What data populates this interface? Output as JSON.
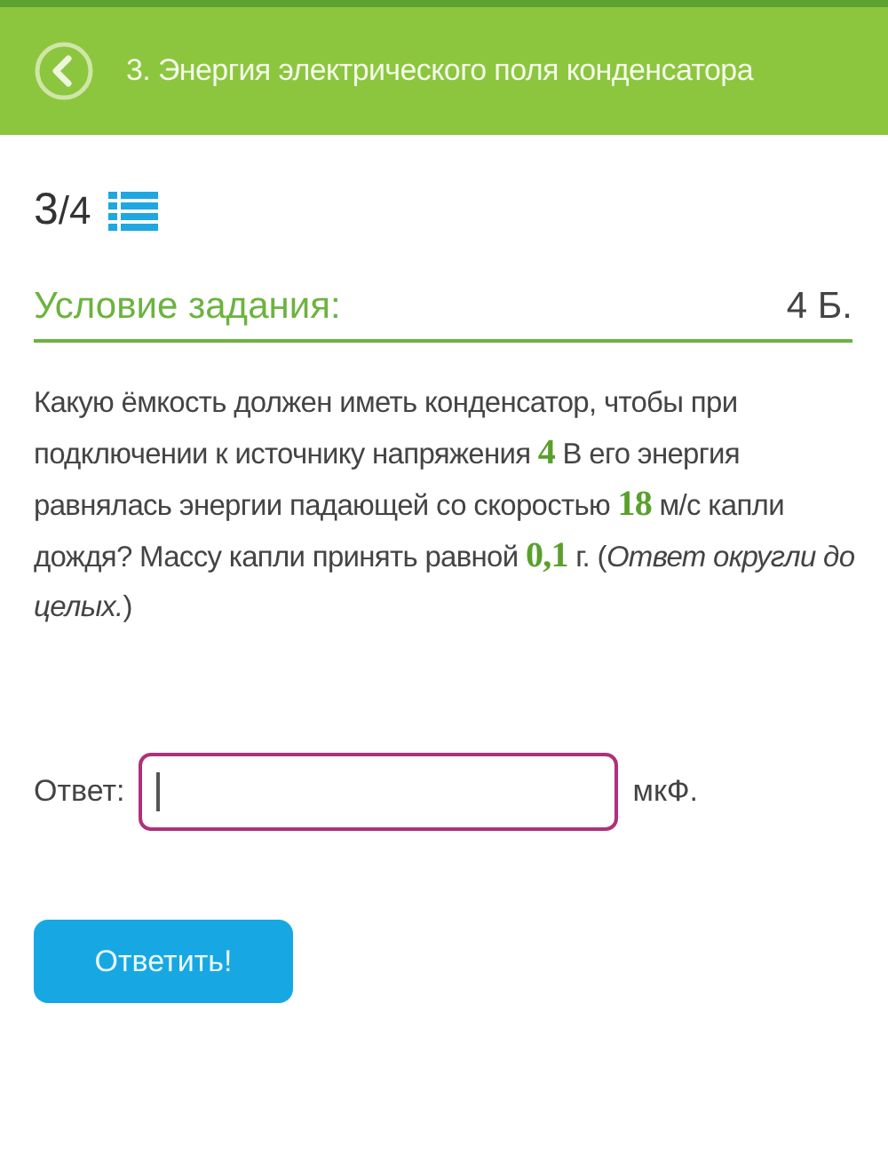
{
  "header": {
    "title": "3. Энергия электрического поля конденсатора"
  },
  "progress": {
    "current": "3",
    "total": "/4"
  },
  "task": {
    "heading": "Условие задания:",
    "points": "4 Б.",
    "text": "Какую ёмкость должен иметь конденсатор, чтобы при подключении к источнику напряжения **4** В его энергия равнялась энергии падающей со скоростью **18** м/с капли дождя? Массу капли принять равной **0,1** г. (*Ответ округли до целых.*)"
  },
  "answer": {
    "label": "Ответ:",
    "unit": "мкФ.",
    "focused": true
  },
  "submit_button": "Ответить!"
}
